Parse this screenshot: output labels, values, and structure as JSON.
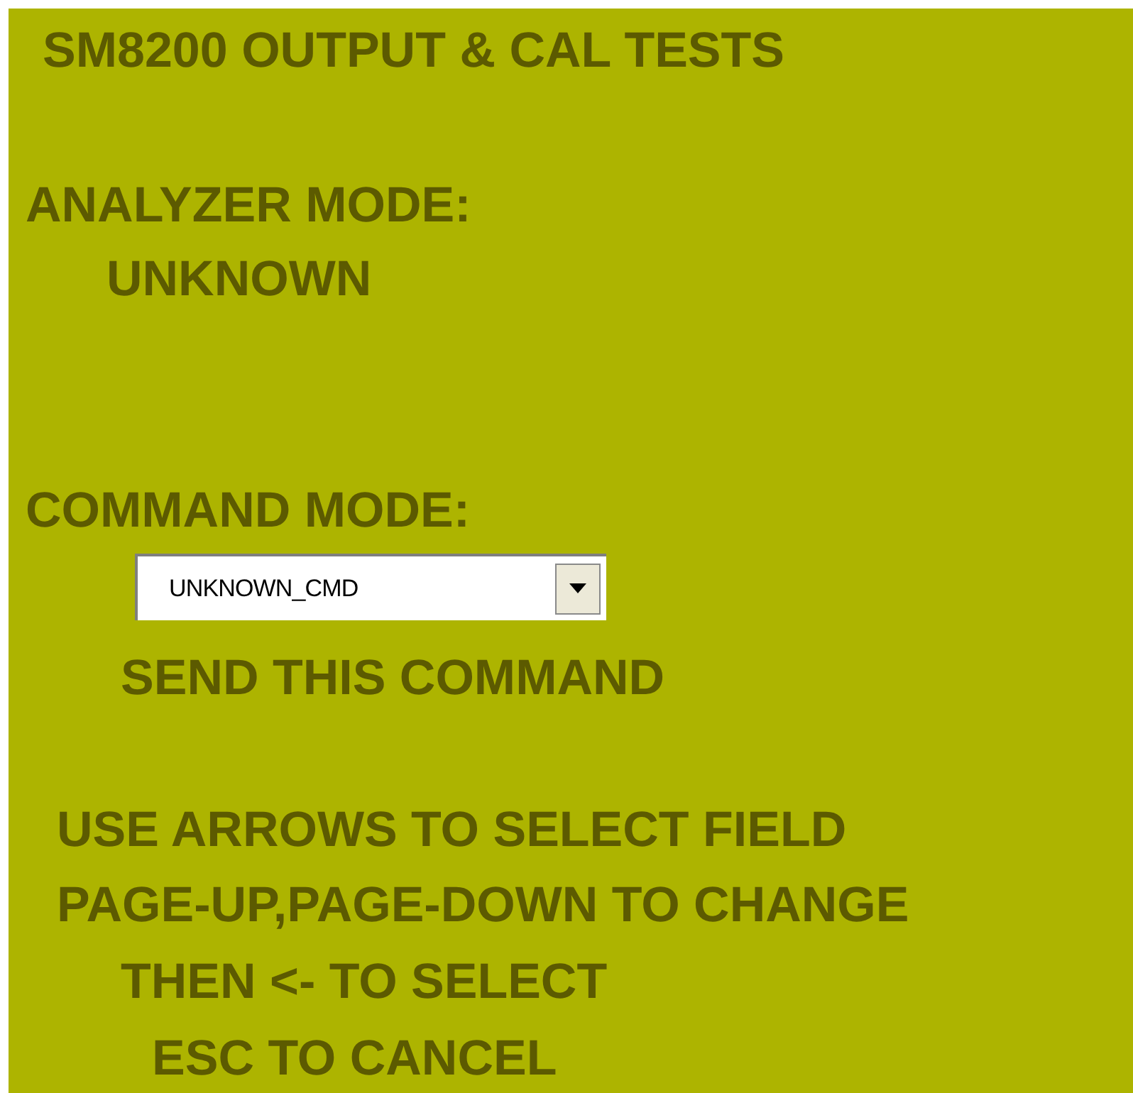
{
  "title": "SM8200 OUTPUT & CAL TESTS",
  "analyzer_mode": {
    "label": "ANALYZER MODE:",
    "value": "UNKNOWN"
  },
  "command_mode": {
    "label": "COMMAND MODE:",
    "dropdown": {
      "value": "UNKNOWN_CMD"
    },
    "send_button": "SEND THIS COMMAND"
  },
  "instructions": [
    {
      "text": "USE ARROWS TO SELECT FIELD"
    },
    {
      "text": "PAGE-UP,PAGE-DOWN TO CHANGE"
    },
    {
      "text": "THEN <- TO SELECT"
    },
    {
      "text": "ESC TO CANCEL"
    }
  ]
}
